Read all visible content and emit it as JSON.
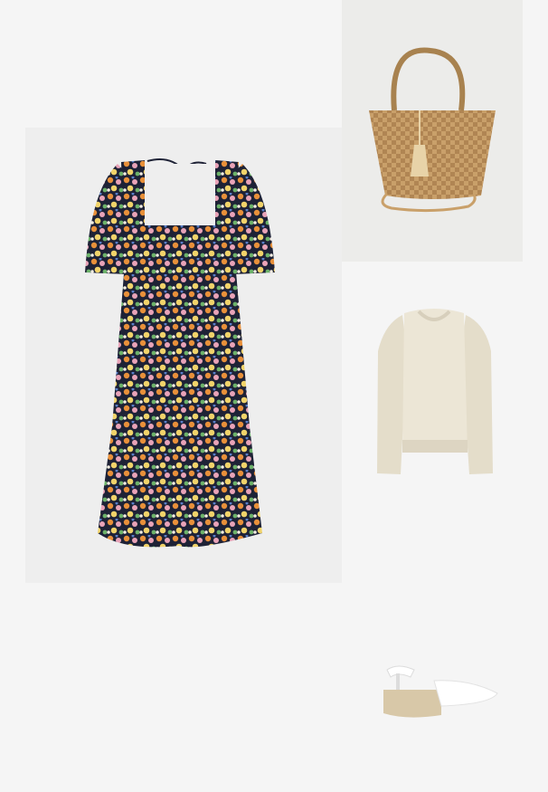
{
  "collage": {
    "items": [
      {
        "name": "floral-midi-dress",
        "palette": [
          "#1e2236",
          "#e8903a",
          "#e9a3b8",
          "#f1d36a",
          "#6cb26a",
          "#f3efe2"
        ]
      },
      {
        "name": "woven-straw-tote",
        "palette": [
          "#c9a06a",
          "#a8824f",
          "#ecece9"
        ]
      },
      {
        "name": "cream-knit-cardigan",
        "palette": [
          "#ece6d6",
          "#d7cfbc"
        ]
      },
      {
        "name": "white-espadrille-wedge",
        "palette": [
          "#ffffff",
          "#d8c8a8"
        ]
      }
    ],
    "background": "#f5f5f5"
  }
}
